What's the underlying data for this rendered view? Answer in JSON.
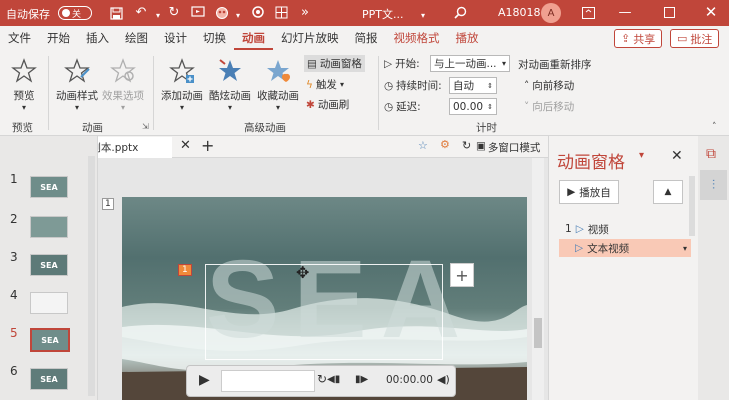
{
  "titlebar": {
    "autosave_label": "自动保存",
    "autosave_state": "关",
    "doc_title": "PPT文...",
    "user_id": "A18018",
    "avatar_initial": "A"
  },
  "menu": {
    "tabs": [
      "文件",
      "开始",
      "插入",
      "绘图",
      "设计",
      "切换",
      "动画",
      "幻灯片放映",
      "简报",
      "视频格式",
      "播放"
    ],
    "active_tab": "动画",
    "share_label": "共享",
    "comment_label": "批注"
  },
  "ribbon": {
    "preview_label": "预览",
    "preview_group": "预览",
    "anim_style_label": "动画样式",
    "effect_options_label": "效果选项",
    "anim_group": "动画",
    "add_anim_label": "添加动画",
    "cool_anim_label": "酷炫动画",
    "fav_anim_label": "收藏动画",
    "anim_pane_label": "动画窗格",
    "trigger_label": "触发",
    "anim_painter_label": "动画刷",
    "advanced_group": "高级动画",
    "start_label": "开始:",
    "start_value": "与上一动画...",
    "duration_label": "持续时间:",
    "duration_value": "自动",
    "delay_label": "延迟:",
    "delay_value": "00.00",
    "timing_group": "计时",
    "reorder_label": "对动画重新排序",
    "move_earlier_label": "向前移动",
    "move_later_label": "向后移动"
  },
  "doc_tab": {
    "filename": "PPT文件 - 副本.pptx",
    "multi_window_label": "多窗口模式"
  },
  "thumbnails": [
    {
      "num": "1",
      "text": "SEA"
    },
    {
      "num": "2",
      "text": ""
    },
    {
      "num": "3",
      "text": "SEA"
    },
    {
      "num": "4",
      "text": ""
    },
    {
      "num": "5",
      "text": "SEA"
    },
    {
      "num": "6",
      "text": "SEA"
    }
  ],
  "selected_slide": "5",
  "slide": {
    "number_marker": "1",
    "anim_badge": "1",
    "big_text": "SEA",
    "video_time": "00:00.00"
  },
  "anim_pane": {
    "title": "动画窗格",
    "play_from_label": "播放自",
    "items": [
      {
        "num": "1",
        "label": "视频"
      },
      {
        "num": "",
        "label": "文本视频"
      }
    ]
  },
  "colors": {
    "accent": "#c0463a",
    "highlight": "#f9c9b6"
  }
}
